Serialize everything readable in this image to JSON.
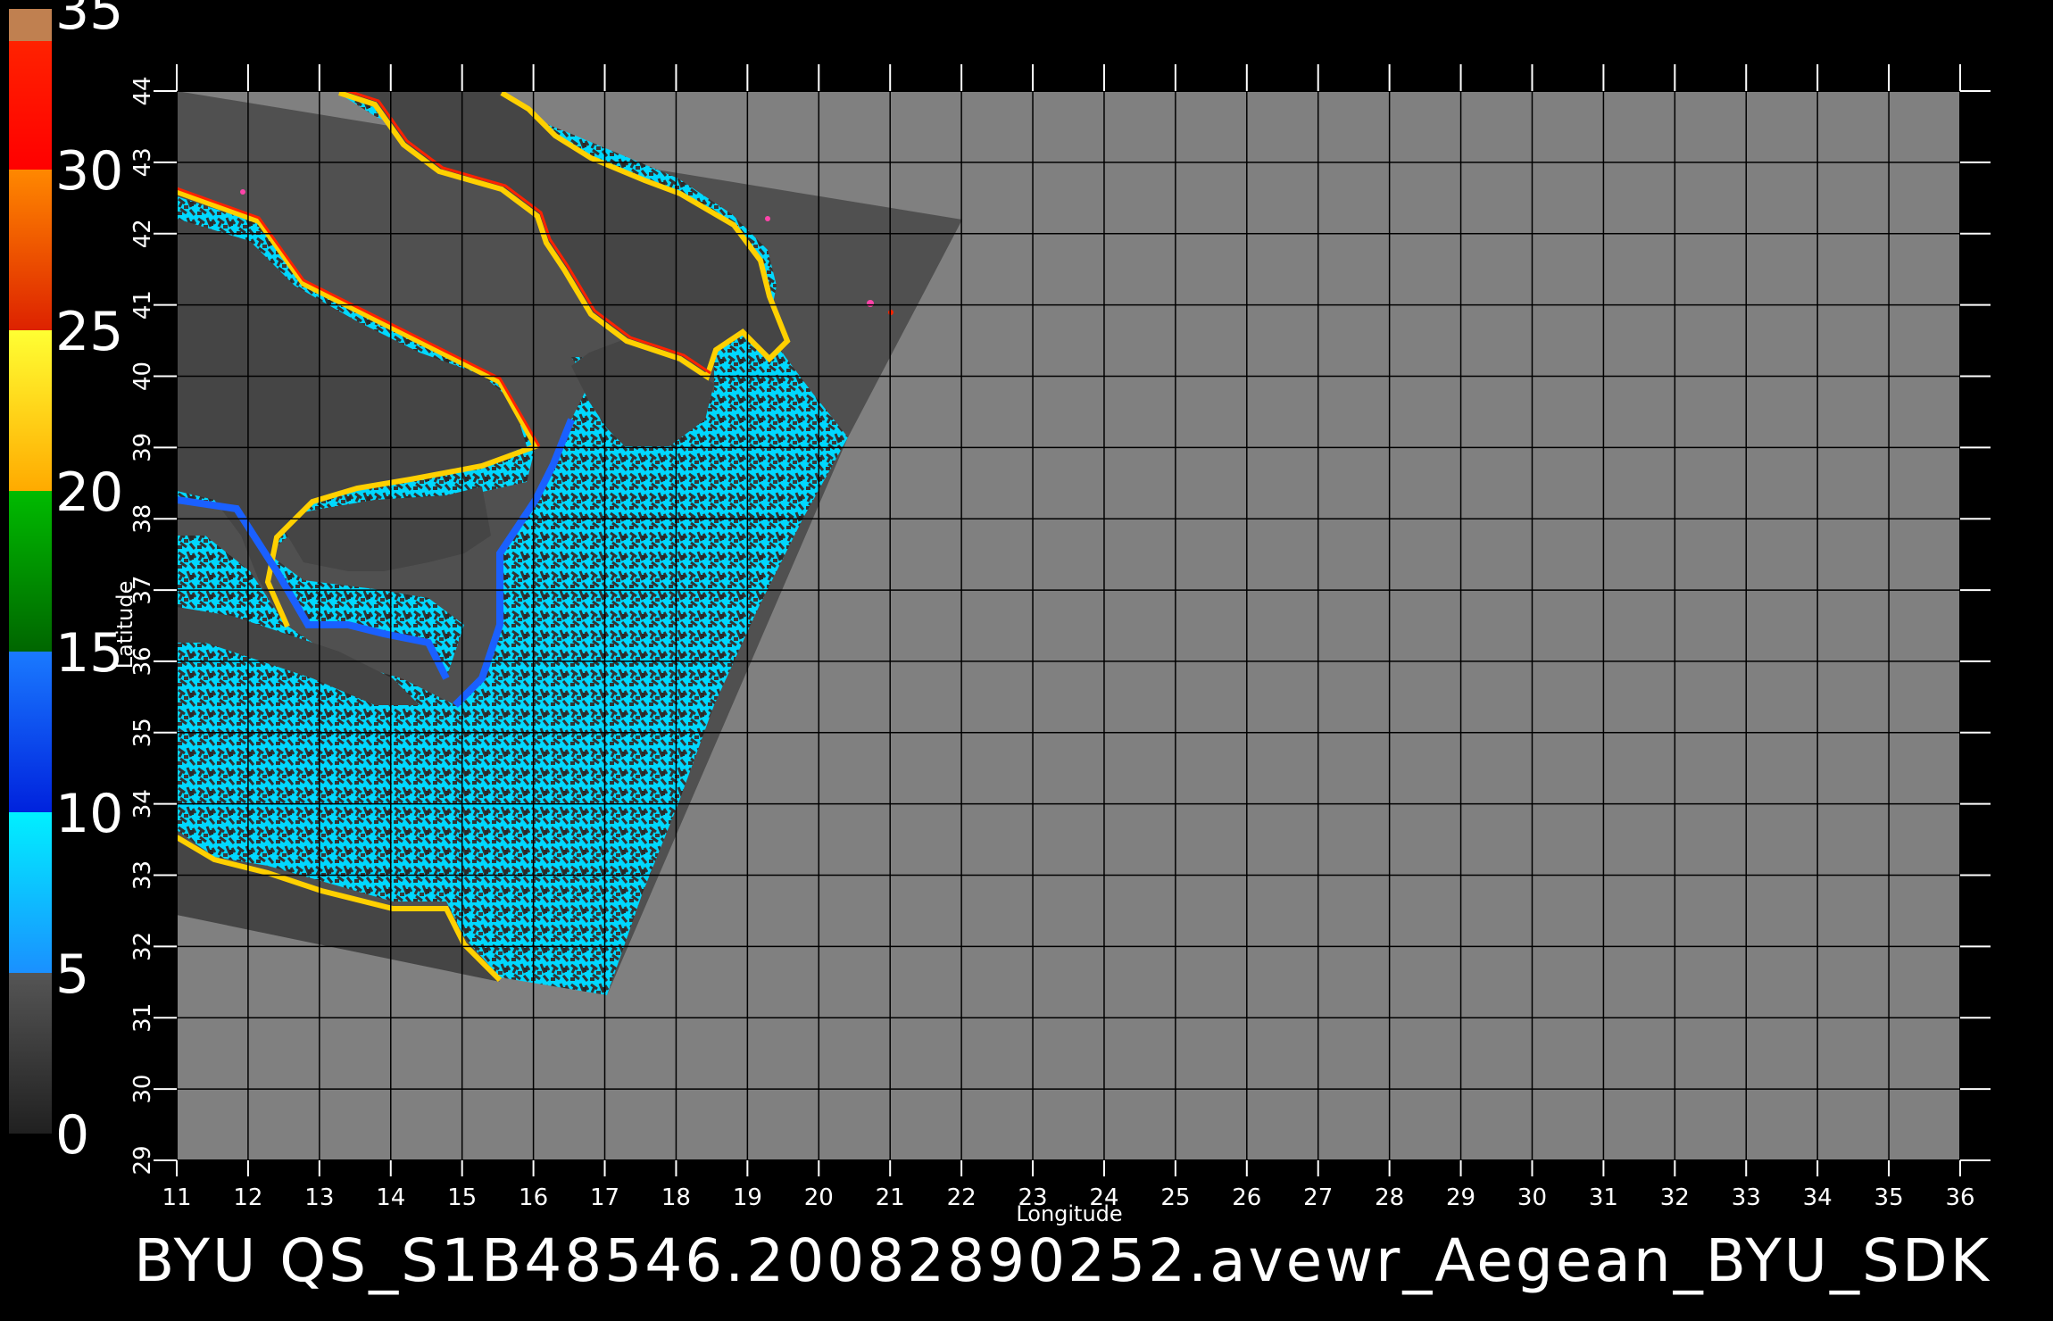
{
  "colorbar": {
    "labels": [
      "35",
      "30",
      "25",
      "20",
      "15",
      "10",
      "5",
      "0"
    ],
    "stops": [
      {
        "from": 0,
        "to": 5,
        "color": "#555555",
        "color2": "#202020"
      },
      {
        "from": 5,
        "to": 10,
        "color": "#00f0ff",
        "color2": "#1a90ff"
      },
      {
        "from": 10,
        "to": 15,
        "color": "#1a7aff",
        "color2": "#0022dd"
      },
      {
        "from": 15,
        "to": 20,
        "color": "#00bb00",
        "color2": "#006600"
      },
      {
        "from": 20,
        "to": 25,
        "color": "#ffff33",
        "color2": "#ffaa00"
      },
      {
        "from": 25,
        "to": 30,
        "color": "#ff8800",
        "color2": "#dd2200"
      },
      {
        "from": 30,
        "to": 34,
        "color": "#ff2200",
        "color2": "#ff0000"
      },
      {
        "from": 34,
        "to": 35,
        "color": "#c08050",
        "color2": "#c08050"
      }
    ]
  },
  "map": {
    "lon_range": [
      11,
      36
    ],
    "lat_range": [
      29,
      44
    ],
    "lon_ticks": [
      "11",
      "12",
      "13",
      "14",
      "15",
      "16",
      "17",
      "18",
      "19",
      "20",
      "21",
      "22",
      "23",
      "24",
      "25",
      "26",
      "27",
      "28",
      "29",
      "30",
      "31",
      "32",
      "33",
      "34",
      "35",
      "36"
    ],
    "lat_ticks": [
      "29",
      "30",
      "31",
      "32",
      "33",
      "34",
      "35",
      "36",
      "37",
      "38",
      "39",
      "40",
      "41",
      "42",
      "43",
      "44"
    ],
    "xlabel": "Longitude",
    "ylabel": "Latitude",
    "background_color": "#808080",
    "swath_color": "#505050",
    "grid_color": "#000000"
  },
  "footer": {
    "title": "BYU  QS_S1B48546.20082890252.avewr_Aegean_BYU_SDK"
  }
}
